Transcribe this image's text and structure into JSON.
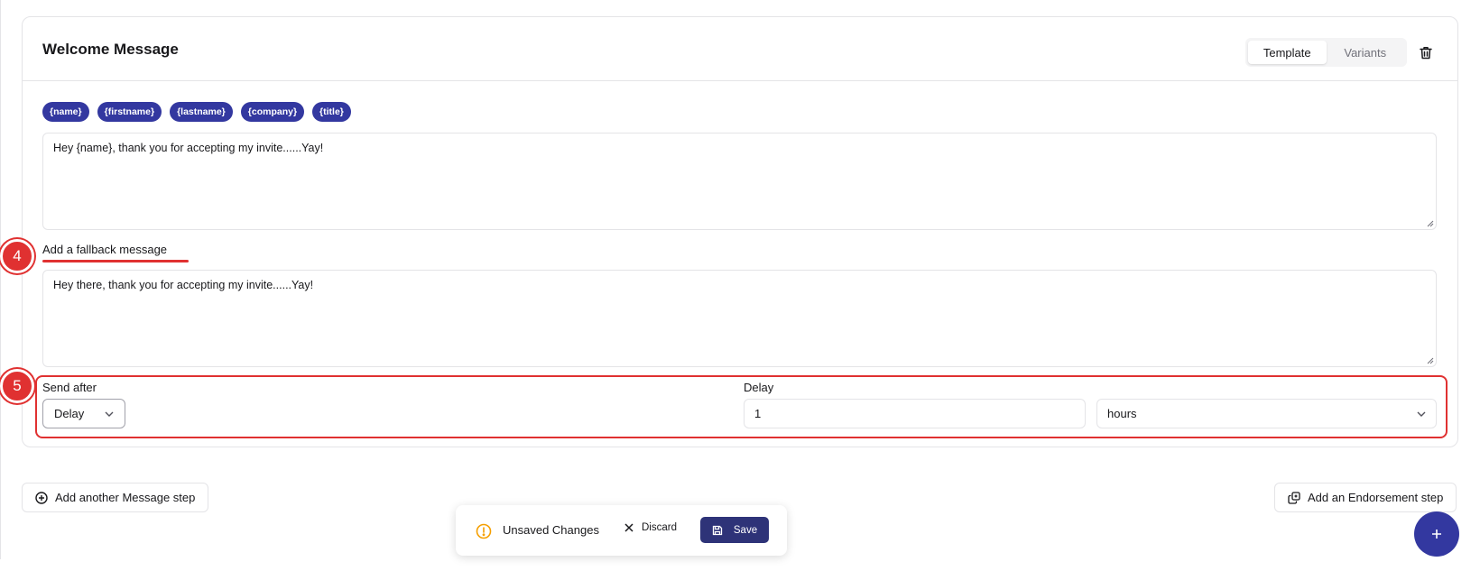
{
  "card": {
    "title": "Welcome Message",
    "tabs": [
      {
        "label": "Template",
        "active": true
      },
      {
        "label": "Variants",
        "active": false
      }
    ]
  },
  "variables": [
    "{name}",
    "{firstname}",
    "{lastname}",
    "{company}",
    "{title}"
  ],
  "message": {
    "value": "Hey {name}, thank you for accepting my invite......Yay!"
  },
  "fallback": {
    "label": "Add a fallback message",
    "value": "Hey there, thank you for accepting my invite......Yay!"
  },
  "callouts": {
    "four": "4",
    "five": "5"
  },
  "send_after": {
    "label": "Send after",
    "selected": "Delay"
  },
  "delay": {
    "label": "Delay",
    "value": "1",
    "unit": "hours"
  },
  "actions": {
    "add_message_step": "Add another Message step",
    "add_endorsement_step": "Add an Endorsement step"
  },
  "toast": {
    "text": "Unsaved Changes",
    "discard": "Discard",
    "save": "Save"
  },
  "colors": {
    "accent": "#3338a0",
    "annotation": "#e03131",
    "save_button": "#2e3378",
    "warning": "#f59f00"
  }
}
